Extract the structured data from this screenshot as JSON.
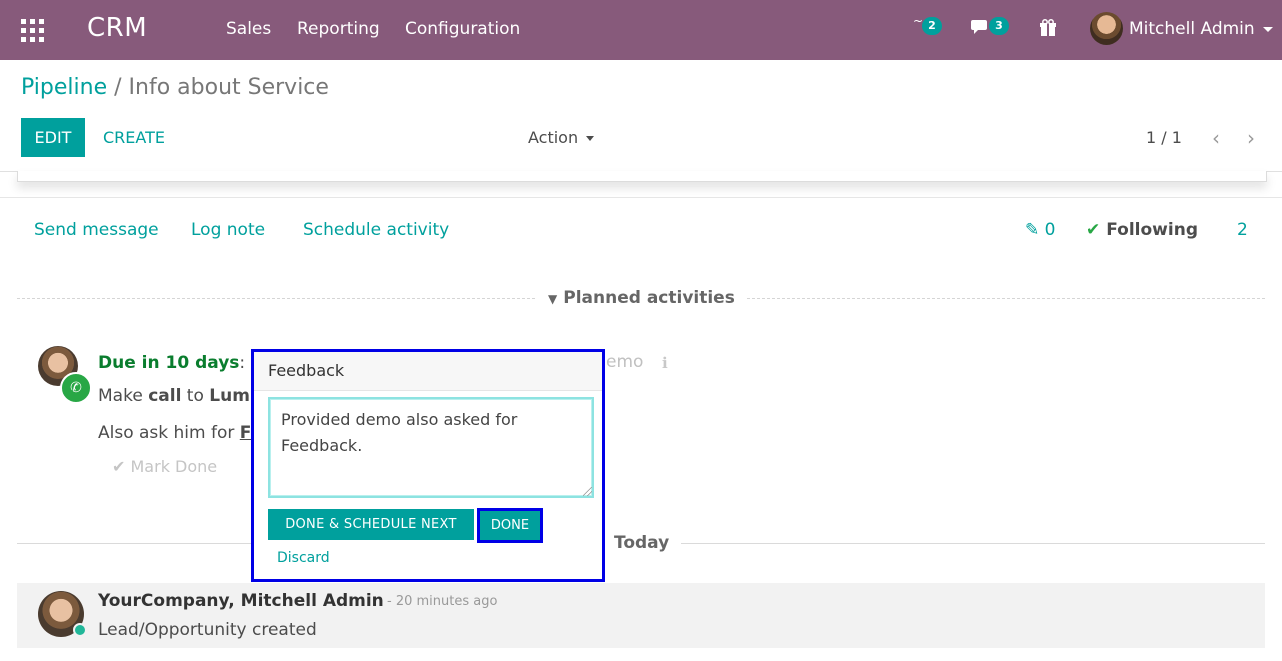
{
  "navbar": {
    "brand": "CRM",
    "menu": [
      "Sales",
      "Reporting",
      "Configuration"
    ],
    "activity_badge": "2",
    "messages_badge": "3",
    "user_name": "Mitchell Admin",
    "bg_color": "#875a7b"
  },
  "control": {
    "breadcrumb_parent": "Pipeline",
    "breadcrumb_sep": "/",
    "breadcrumb_current": "Info about Service",
    "edit_label": "EDIT",
    "create_label": "CREATE",
    "action_label": "Action",
    "pager": "1 / 1"
  },
  "chatter": {
    "send_message": "Send message",
    "log_note": "Log note",
    "schedule_activity": "Schedule activity",
    "attachments_count": "0",
    "following_label": "Following",
    "followers_count": "2",
    "planned_label": "Planned activities",
    "today_label": "Today"
  },
  "activity": {
    "due": "Due in 10 days",
    "suffix": ":",
    "line1_prefix": "Make ",
    "line1_bold": "call",
    "line1_mid": " to ",
    "line1_name": "Lum",
    "line2_prefix": "Also ask him for ",
    "line2_bold": "F",
    "mark_done": "Mark Done",
    "demo_fragment": "emo"
  },
  "message": {
    "author": "YourCompany, Mitchell Admin",
    "date": "- 20 minutes ago",
    "body": "Lead/Opportunity created"
  },
  "popover": {
    "title": "Feedback",
    "feedback_value": "Provided demo also asked for Feedback.",
    "done_schedule_next": "DONE & SCHEDULE NEXT",
    "done": "DONE",
    "discard": "Discard"
  },
  "colors": {
    "accent": "#00a09d",
    "highlight_border": "#0000e6",
    "due_green": "#0a7d2e"
  }
}
